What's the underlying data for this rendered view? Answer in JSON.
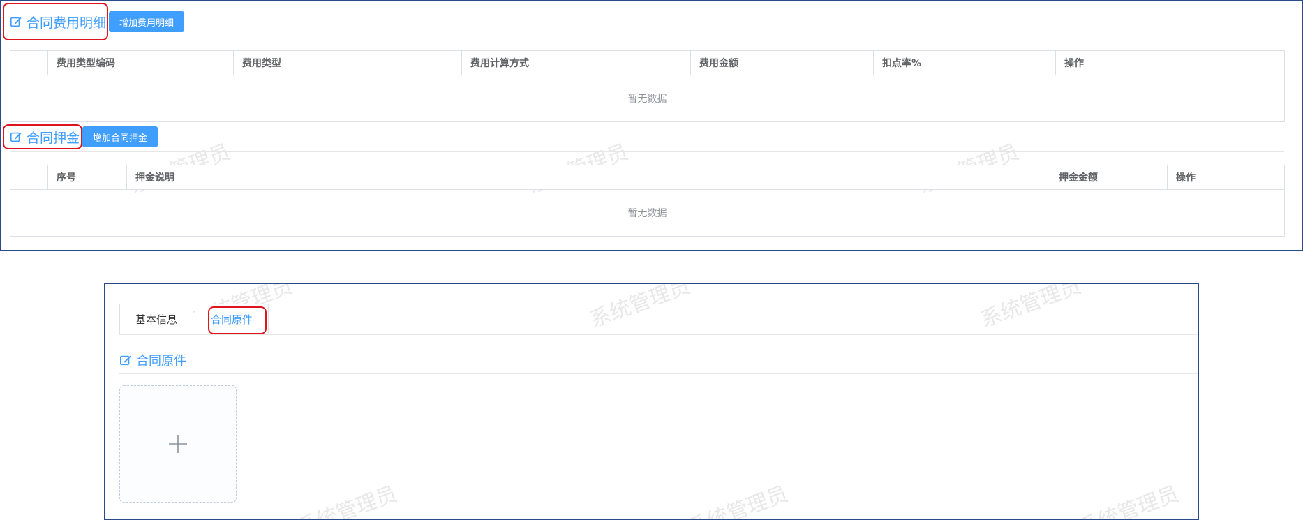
{
  "fee_section": {
    "title": "合同费用明细",
    "add_button": "增加费用明细",
    "columns": [
      "",
      "费用类型编码",
      "费用类型",
      "费用计算方式",
      "费用金额",
      "扣点率%",
      "操作"
    ],
    "empty_text": "暂无数据"
  },
  "deposit_section": {
    "title": "合同押金",
    "add_button": "增加合同押金",
    "columns": [
      "",
      "序号",
      "押金说明",
      "押金金额",
      "操作"
    ],
    "empty_text": "暂无数据"
  },
  "tabs": [
    {
      "label": "基本信息",
      "active": false
    },
    {
      "label": "合同原件",
      "active": true
    }
  ],
  "original_section": {
    "title": "合同原件",
    "upload_icon": "plus-icon"
  },
  "watermark": "系统管理员",
  "colors": {
    "accent": "#409eff",
    "highlight": "#e0141e",
    "frame": "#2b4a8c"
  }
}
